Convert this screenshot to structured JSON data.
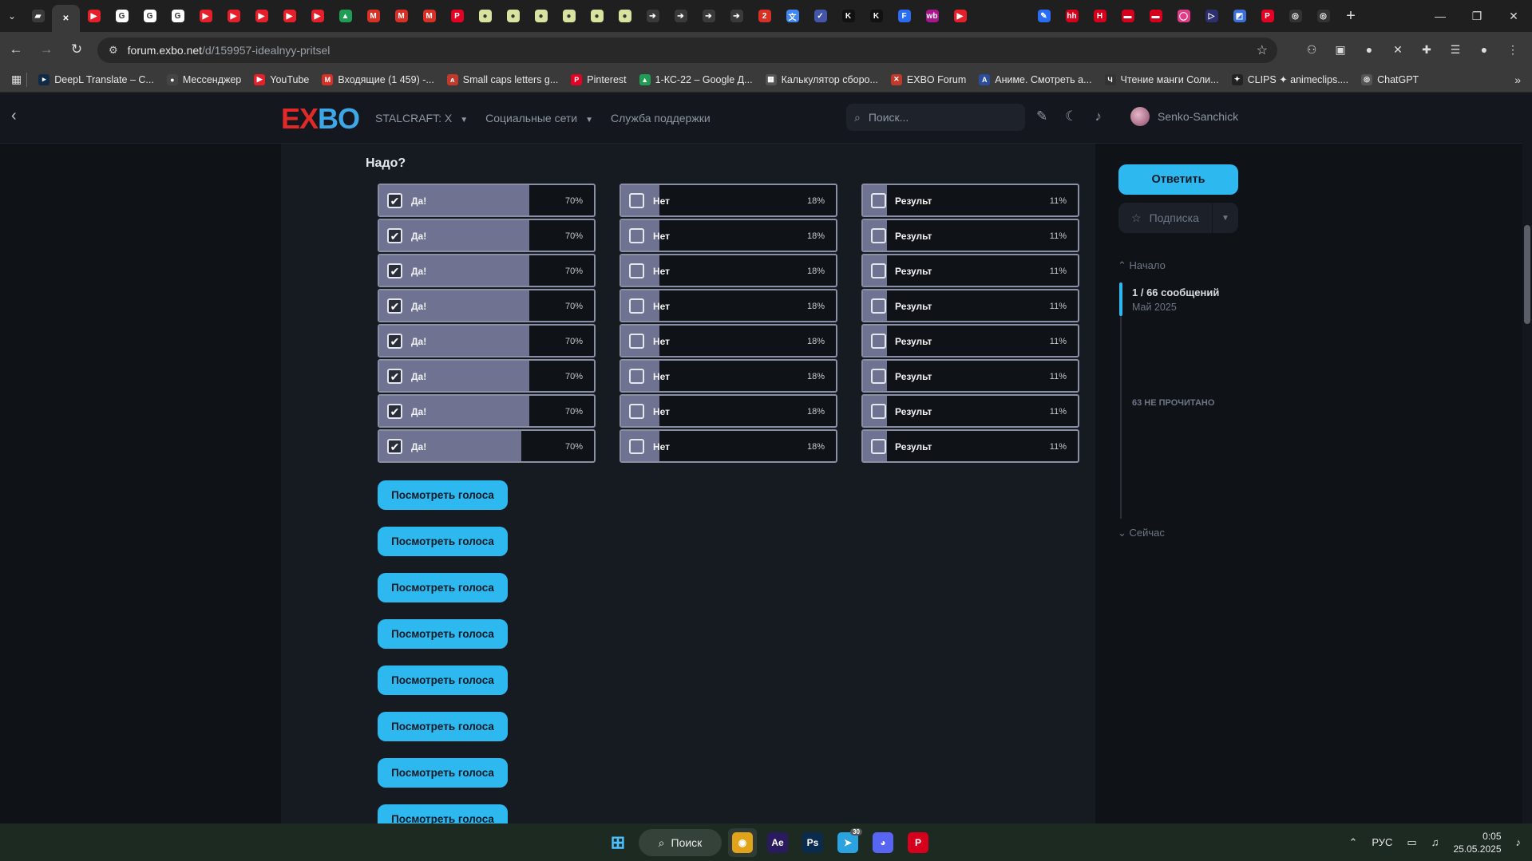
{
  "browser": {
    "tabs": [
      {
        "icon": "chat-icon",
        "color": "#3a3a3a",
        "glyph": "▰"
      },
      {
        "icon": "close-icon",
        "color": "#3a3a3a",
        "glyph": "✕"
      },
      {
        "icon": "youtube-icon",
        "color": "#e5202a",
        "glyph": "▶"
      },
      {
        "icon": "google-icon",
        "color": "#ffffff",
        "glyph": "G"
      },
      {
        "icon": "google-icon",
        "color": "#ffffff",
        "glyph": "G"
      },
      {
        "icon": "google-icon",
        "color": "#ffffff",
        "glyph": "G"
      },
      {
        "icon": "youtube-icon",
        "color": "#e5202a",
        "glyph": "▶"
      },
      {
        "icon": "youtube-icon",
        "color": "#e5202a",
        "glyph": "▶"
      },
      {
        "icon": "youtube-icon",
        "color": "#e5202a",
        "glyph": "▶"
      },
      {
        "icon": "youtube-icon",
        "color": "#e5202a",
        "glyph": "▶"
      },
      {
        "icon": "youtube-icon",
        "color": "#e5202a",
        "glyph": "▶"
      },
      {
        "icon": "drive-icon",
        "color": "#1f9d55",
        "glyph": "▲"
      },
      {
        "icon": "gmail-icon",
        "color": "#d93025",
        "glyph": "M"
      },
      {
        "icon": "gmail-icon",
        "color": "#d93025",
        "glyph": "M"
      },
      {
        "icon": "gmail-icon",
        "color": "#d93025",
        "glyph": "M"
      },
      {
        "icon": "pinterest-icon",
        "color": "#e60023",
        "glyph": "P"
      },
      {
        "icon": "ball-icon",
        "color": "#d8e3a0",
        "glyph": "●"
      },
      {
        "icon": "ball-icon",
        "color": "#d8e3a0",
        "glyph": "●"
      },
      {
        "icon": "ball-icon",
        "color": "#d8e3a0",
        "glyph": "●"
      },
      {
        "icon": "ball-icon",
        "color": "#d8e3a0",
        "glyph": "●"
      },
      {
        "icon": "ball-icon",
        "color": "#d8e3a0",
        "glyph": "●"
      },
      {
        "icon": "ball-icon",
        "color": "#d8e3a0",
        "glyph": "●"
      },
      {
        "icon": "arrow-icon",
        "color": "#3a3a3a",
        "glyph": "➔"
      },
      {
        "icon": "arrow-icon",
        "color": "#3a3a3a",
        "glyph": "➔"
      },
      {
        "icon": "arrow-icon",
        "color": "#3a3a3a",
        "glyph": "➔"
      },
      {
        "icon": "arrow-icon",
        "color": "#3a3a3a",
        "glyph": "➔"
      },
      {
        "icon": "red-badge-icon",
        "color": "#d93025",
        "glyph": "2"
      },
      {
        "icon": "translate-icon",
        "color": "#4285f4",
        "glyph": "文"
      },
      {
        "icon": "check-icon",
        "color": "#4455aa",
        "glyph": "✓"
      },
      {
        "icon": "k-icon",
        "color": "#111111",
        "glyph": "K"
      },
      {
        "icon": "k-icon",
        "color": "#111111",
        "glyph": "K"
      },
      {
        "icon": "f-icon",
        "color": "#2b6cf5",
        "glyph": "F"
      },
      {
        "icon": "wb-icon",
        "color": "#a8158c",
        "glyph": "wb"
      },
      {
        "icon": "youtube-icon",
        "color": "#e5202a",
        "glyph": "▶"
      },
      {
        "icon": "blank-icon",
        "color": "#1f1f1f",
        "glyph": ""
      },
      {
        "icon": "blank-icon",
        "color": "#1f1f1f",
        "glyph": ""
      },
      {
        "icon": "feather-icon",
        "color": "#2a6df5",
        "glyph": "✎"
      },
      {
        "icon": "hh-icon",
        "color": "#d6001c",
        "glyph": "hh"
      },
      {
        "icon": "h-icon",
        "color": "#d6001c",
        "glyph": "H"
      },
      {
        "icon": "red-tab-icon",
        "color": "#d6001c",
        "glyph": "▬"
      },
      {
        "icon": "red-tab-icon",
        "color": "#d6001c",
        "glyph": "▬"
      },
      {
        "icon": "ring-icon",
        "color": "#e03d86",
        "glyph": "◯"
      },
      {
        "icon": "play-icon",
        "color": "#2f2f6f",
        "glyph": "▷"
      },
      {
        "icon": "chart-icon",
        "color": "#3d6fd8",
        "glyph": "◩"
      },
      {
        "icon": "pinterest-icon",
        "color": "#e60023",
        "glyph": "P"
      },
      {
        "icon": "instagram-icon",
        "color": "#333333",
        "glyph": "◎"
      },
      {
        "icon": "instagram-icon",
        "color": "#333333",
        "glyph": "◎"
      }
    ],
    "url_host": "forum.exbo.net",
    "url_path": "/d/159957-idealnyy-pritsel",
    "bookmarks": [
      {
        "icon": "deepl-icon",
        "color": "#0f2b46",
        "glyph": "▸",
        "label": "DeepL Translate – С..."
      },
      {
        "icon": "messenger-icon",
        "color": "#444444",
        "glyph": "●",
        "label": "Мессенджер"
      },
      {
        "icon": "youtube-icon",
        "color": "#e5202a",
        "glyph": "▶",
        "label": "YouTube"
      },
      {
        "icon": "gmail-icon",
        "color": "#d93025",
        "glyph": "M",
        "label": "Входящие (1 459) -..."
      },
      {
        "icon": "smallcaps-icon",
        "color": "#c0392b",
        "glyph": "ᴀ",
        "label": "Small caps letters g..."
      },
      {
        "icon": "pinterest-icon",
        "color": "#e60023",
        "glyph": "P",
        "label": "Pinterest"
      },
      {
        "icon": "drive-icon",
        "color": "#1f9d55",
        "glyph": "▲",
        "label": "1-КС-22 – Google Д..."
      },
      {
        "icon": "calc-icon",
        "color": "#555555",
        "glyph": "▦",
        "label": "Калькулятор сборо..."
      },
      {
        "icon": "exbo-icon",
        "color": "#c0392b",
        "glyph": "✕",
        "label": "EXBO Forum"
      },
      {
        "icon": "anime-icon",
        "color": "#2a4d9c",
        "glyph": "A",
        "label": "Аниме. Смотреть а..."
      },
      {
        "icon": "manga-icon",
        "color": "#333333",
        "glyph": "Ч",
        "label": "Чтение манги Соли..."
      },
      {
        "icon": "clips-icon",
        "color": "#222222",
        "glyph": "✦",
        "label": "CLIPS ✦ animeclips...."
      },
      {
        "icon": "chatgpt-icon",
        "color": "#555555",
        "glyph": "◎",
        "label": "ChatGPT"
      }
    ]
  },
  "site": {
    "logo_e": "EX",
    "logo_rest": "BO",
    "nav": [
      "STALCRAFT: X",
      "Социальные сети",
      "Служба поддержки"
    ],
    "search_placeholder": "Поиск...",
    "username": "Senko-Sanchick"
  },
  "poll": {
    "title": "Надо?",
    "columns": [
      {
        "label": "Да!",
        "percent": "70%",
        "fill": 0.7,
        "checked": true
      },
      {
        "label": "Нет",
        "percent": "18%",
        "fill": 0.18,
        "checked": false
      },
      {
        "label": "Результ",
        "percent": "11%",
        "fill": 0.11,
        "checked": false
      }
    ],
    "row_count": 8,
    "view_votes_label": "Посмотреть голоса",
    "view_votes_count": 8
  },
  "sidebar": {
    "reply_label": "Ответить",
    "subscribe_label": "Подписка",
    "start_label": "Начало",
    "progress": "1 / 66 сообщений",
    "date": "Май 2025",
    "unread": "63 НЕ ПРОЧИТАНО",
    "now_label": "Сейчас"
  },
  "taskbar": {
    "search_label": "Поиск",
    "apps": [
      {
        "icon": "chrome-icon",
        "color": "#e0a31a",
        "glyph": "◉",
        "active": true
      },
      {
        "icon": "after-effects-icon",
        "color": "#2a1a5e",
        "glyph": "Ae"
      },
      {
        "icon": "photoshop-icon",
        "color": "#0a2a4e",
        "glyph": "Ps"
      },
      {
        "icon": "telegram-icon",
        "color": "#2aa3e0",
        "glyph": "➤",
        "badge": "30"
      },
      {
        "icon": "discord-icon",
        "color": "#5865f2",
        "glyph": "◕"
      },
      {
        "icon": "pointer-app-icon",
        "color": "#d6001c",
        "glyph": "P"
      }
    ],
    "lang": "РУС",
    "time": "0:05",
    "date": "25.05.2025"
  }
}
